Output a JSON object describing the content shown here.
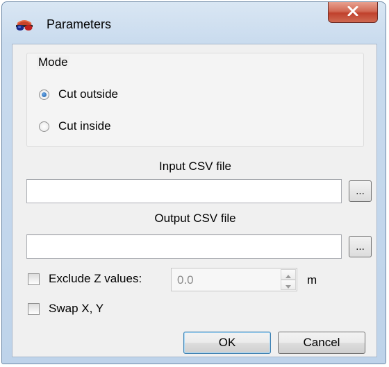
{
  "window": {
    "title": "Parameters",
    "close_label": "X"
  },
  "mode_group": {
    "title": "Mode",
    "options": [
      {
        "label": "Cut outside",
        "checked": true
      },
      {
        "label": "Cut inside",
        "checked": false
      }
    ]
  },
  "input_file": {
    "label": "Input CSV file",
    "value": "",
    "browse_label": "..."
  },
  "output_file": {
    "label": "Output CSV file",
    "value": "",
    "browse_label": "..."
  },
  "exclude_z": {
    "label": "Exclude Z values:",
    "checked": false,
    "value": "0.0",
    "unit": "m"
  },
  "swap_xy": {
    "label": "Swap X, Y",
    "checked": false
  },
  "buttons": {
    "ok": "OK",
    "cancel": "Cancel"
  },
  "icons": {
    "app": "red-glasses-icon",
    "close": "close-icon"
  }
}
